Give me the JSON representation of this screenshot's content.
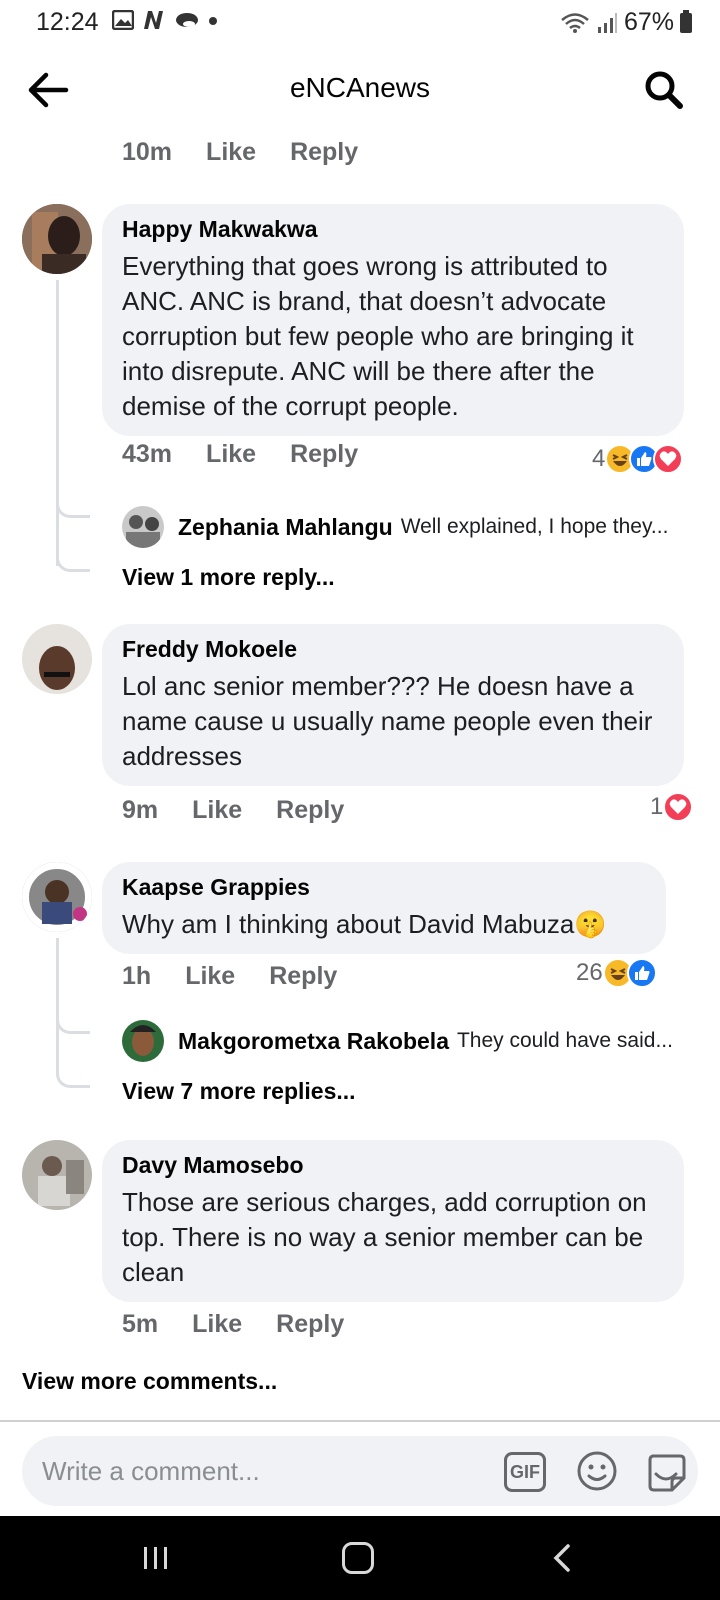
{
  "status_bar": {
    "time": "12:24",
    "battery": "67%"
  },
  "header": {
    "title": "eNCAnews"
  },
  "top_meta": {
    "time": "10m",
    "like": "Like",
    "reply": "Reply"
  },
  "comments": [
    {
      "author": "Happy Makwakwa",
      "text": "Everything that goes wrong is attributed to ANC. ANC is brand, that doesn’t advocate corruption but few people who are bringing it into disrepute. ANC will be there after the demise of the corrupt people.",
      "time": "43m",
      "like": "Like",
      "reply": "Reply",
      "reaction_count": "4",
      "reactions": [
        "haha-emoji",
        "like-emoji",
        "love-emoji"
      ],
      "reply_preview": {
        "author": "Zephania Mahlangu",
        "text": "Well explained, I hope they..."
      },
      "view_more": "View 1 more reply..."
    },
    {
      "author": "Freddy Mokoele",
      "text": "Lol anc senior  member??? He doesn have a name cause u usually name people even their addresses",
      "time": "9m",
      "like": "Like",
      "reply": "Reply",
      "reaction_count": "1",
      "reactions": [
        "love-emoji"
      ]
    },
    {
      "author": "Kaapse Grappies",
      "text": "Why am I thinking about David Mabuza🤫",
      "time": "1h",
      "like": "Like",
      "reply": "Reply",
      "reaction_count": "26",
      "reactions": [
        "haha-emoji",
        "like-emoji"
      ],
      "reply_preview": {
        "author": "Makgorometxa Rakobela",
        "text": "They could have said..."
      },
      "view_more": "View 7 more replies..."
    },
    {
      "author": "Davy Mamosebo",
      "text": "Those are serious charges, add corruption on top. There is no way a senior member can be clean",
      "time": "5m",
      "like": "Like",
      "reply": "Reply"
    }
  ],
  "view_more_comments": "View more comments...",
  "composer": {
    "placeholder": "Write a comment...",
    "gif": "GIF"
  },
  "colors": {
    "bubble": "#f0f2f5",
    "meta": "#65676b",
    "like": "#1877f2",
    "love": "#f33e58",
    "haha": "#f7b928"
  }
}
